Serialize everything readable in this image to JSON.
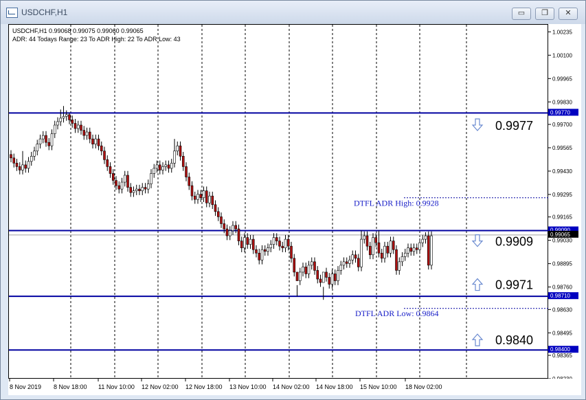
{
  "window": {
    "title": "USDCHF,H1",
    "minimize_label": "▭",
    "restore_label": "❐",
    "close_label": "✕"
  },
  "chart_info": {
    "line1": "USDCHF,H1  0.99068 0.99075 0.99060 0.99065",
    "line2": "ADR: 44   Todays Range: 23   To ADR High: 22   To ADR Low: 43"
  },
  "chart_data": {
    "type": "candlestick",
    "symbol": "USDCHF",
    "timeframe": "H1",
    "ylim": [
      0.9823,
      1.0028
    ],
    "y_ticks": [
      "1.00235",
      "1.00100",
      "0.99965",
      "0.99830",
      "0.99700",
      "0.99565",
      "0.99430",
      "0.99295",
      "0.99165",
      "0.99030",
      "0.98895",
      "0.98760",
      "0.98630",
      "0.98495",
      "0.98365",
      "0.98230"
    ],
    "x_ticks": [
      "8 Nov 2019",
      "8 Nov 18:00",
      "11 Nov 10:00",
      "12 Nov 02:00",
      "12 Nov 18:00",
      "13 Nov 10:00",
      "14 Nov 02:00",
      "14 Nov 18:00",
      "15 Nov 10:00",
      "18 Nov 02:00"
    ],
    "levels": [
      {
        "price": 0.9977,
        "label": "0.99770",
        "color": "#0000a0"
      },
      {
        "price": 0.9909,
        "label": "0.99090",
        "color": "#0000a0"
      },
      {
        "price": 0.9871,
        "label": "0.98710",
        "color": "#0000a0"
      },
      {
        "price": 0.984,
        "label": "0.98400",
        "color": "#0000a0"
      }
    ],
    "current_price_label": "0.99065",
    "current_price": 0.99065,
    "adr_high": {
      "text": "DTFL ADR High: 0.9928",
      "price": 0.9928
    },
    "adr_low": {
      "text": "DTFL ADR Low: 0.9864",
      "price": 0.9864
    },
    "annotations": [
      {
        "arrow": "down",
        "text": "0.9977",
        "price": 0.997
      },
      {
        "arrow": "down",
        "text": "0.9909",
        "price": 0.9903
      },
      {
        "arrow": "up",
        "text": "0.9971",
        "price": 0.9878
      },
      {
        "arrow": "up",
        "text": "0.9840",
        "price": 0.9846
      }
    ],
    "closes": [
      0.9951,
      0.9948,
      0.9946,
      0.9944,
      0.9947,
      0.9945,
      0.9949,
      0.9952,
      0.9955,
      0.9959,
      0.9962,
      0.9964,
      0.996,
      0.9958,
      0.9965,
      0.997,
      0.9972,
      0.9974,
      0.9975,
      0.9976,
      0.9973,
      0.9971,
      0.9968,
      0.997,
      0.9967,
      0.9964,
      0.9966,
      0.9962,
      0.9959,
      0.9962,
      0.9958,
      0.9955,
      0.995,
      0.9946,
      0.9942,
      0.9938,
      0.9935,
      0.9933,
      0.9937,
      0.9941,
      0.9934,
      0.9931,
      0.9932,
      0.9933,
      0.9932,
      0.9934,
      0.9933,
      0.9936,
      0.9942,
      0.9945,
      0.9947,
      0.9944,
      0.9946,
      0.9947,
      0.9945,
      0.9948,
      0.9955,
      0.9958,
      0.9952,
      0.9946,
      0.994,
      0.9935,
      0.9929,
      0.9927,
      0.993,
      0.9928,
      0.9932,
      0.9925,
      0.9929,
      0.9924,
      0.992,
      0.9917,
      0.9913,
      0.991,
      0.9906,
      0.9909,
      0.9912,
      0.991,
      0.9903,
      0.9899,
      0.9905,
      0.9901,
      0.9904,
      0.9898,
      0.9896,
      0.9892,
      0.9898,
      0.9897,
      0.9899,
      0.9901,
      0.9905,
      0.9903,
      0.99,
      0.9899,
      0.9904,
      0.99,
      0.9893,
      0.9885,
      0.988,
      0.9885,
      0.9888,
      0.9884,
      0.9889,
      0.9891,
      0.9886,
      0.9881,
      0.9879,
      0.9885,
      0.9882,
      0.9878,
      0.9884,
      0.988,
      0.9886,
      0.9889,
      0.9891,
      0.989,
      0.9892,
      0.9895,
      0.9893,
      0.9888,
      0.9904,
      0.9906,
      0.99,
      0.9895,
      0.9905,
      0.9902,
      0.9896,
      0.9893,
      0.99,
      0.9896,
      0.9903,
      0.9898,
      0.9886,
      0.9891,
      0.9894,
      0.9896,
      0.9899,
      0.9897,
      0.9899,
      0.9898,
      0.9902,
      0.9904,
      0.9906,
      0.9889,
      0.9906
    ]
  }
}
